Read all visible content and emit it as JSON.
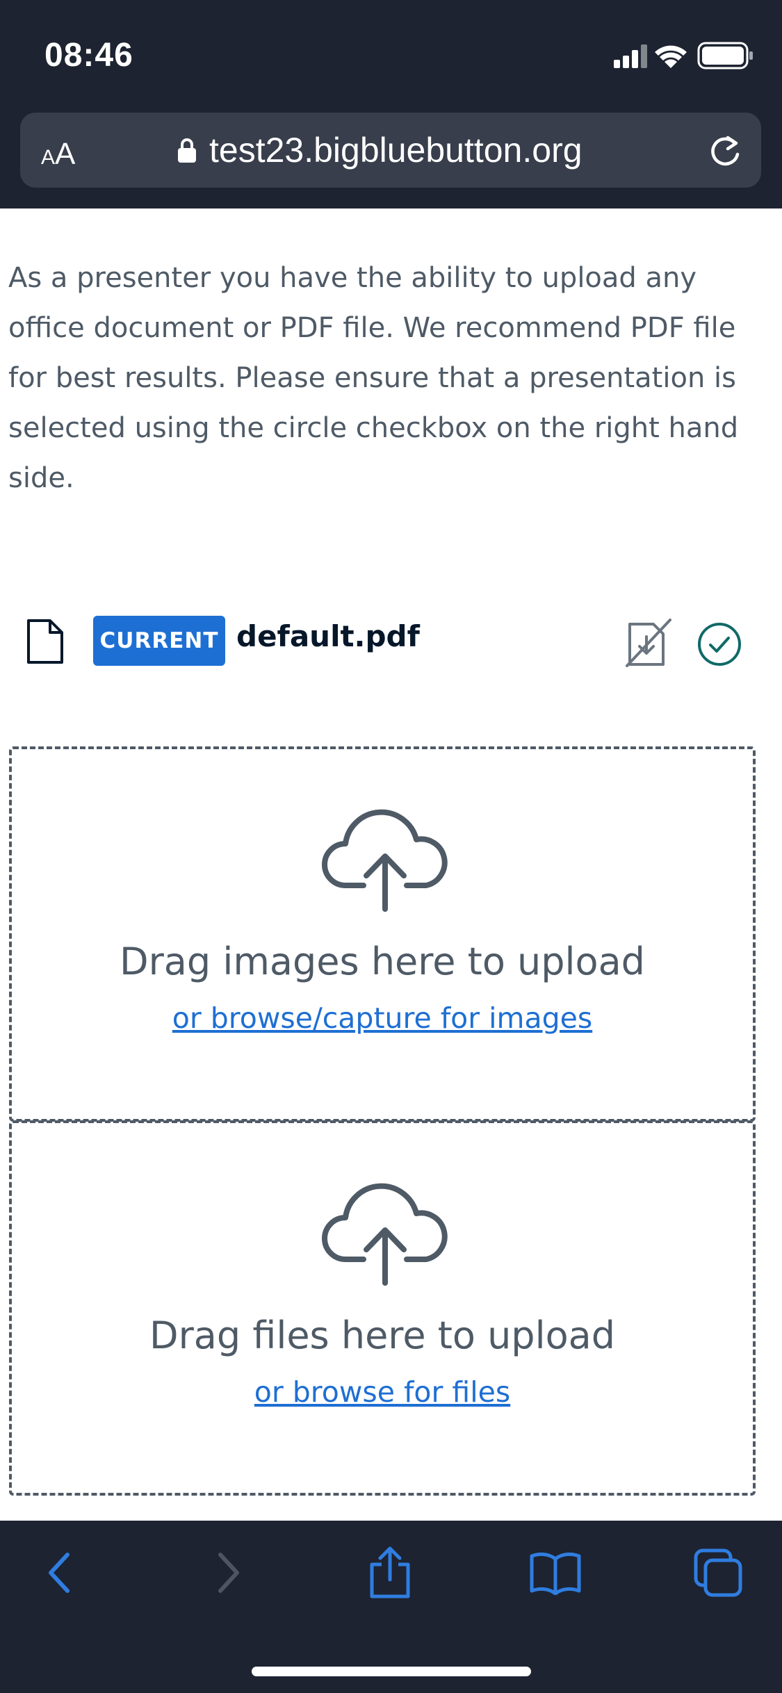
{
  "status_bar": {
    "time": "08:46",
    "icons": [
      "cellular-signal-icon",
      "wifi-icon",
      "battery-icon"
    ]
  },
  "browser": {
    "text_size_label_small": "A",
    "text_size_label_large": "A",
    "url": "test23.bigbluebutton.org",
    "lock_icon": "lock-icon",
    "reload_icon": "reload-icon"
  },
  "content": {
    "intro": "As a presenter you have the ability to upload any office document or PDF file. We recommend PDF file for best results. Please ensure that a presentation is selected using the circle checkbox on the right hand side.",
    "presentation": {
      "badge": "CURRENT",
      "file_name": "default.pdf",
      "file_icon": "file-icon",
      "download_icon": "download-disabled-icon",
      "current_icon": "check-circle-icon"
    },
    "image_dropzone": {
      "title": "Drag images here to upload",
      "link": "or browse/capture for images",
      "icon": "cloud-upload-icon"
    },
    "file_dropzone": {
      "title": "Drag files here to upload",
      "link": "or browse for files",
      "icon": "cloud-upload-icon"
    }
  },
  "toolbar": {
    "buttons": [
      "back-icon",
      "forward-icon",
      "share-icon",
      "bookmarks-icon",
      "tabs-icon"
    ]
  },
  "colors": {
    "chrome_bg": "#1d2331",
    "url_bar_bg": "#383e4b",
    "accent_blue": "#1e6fd3",
    "text_gray": "#4e5a66",
    "check_teal": "#0f6a68",
    "toolbar_icon_blue": "#2f7de0"
  }
}
